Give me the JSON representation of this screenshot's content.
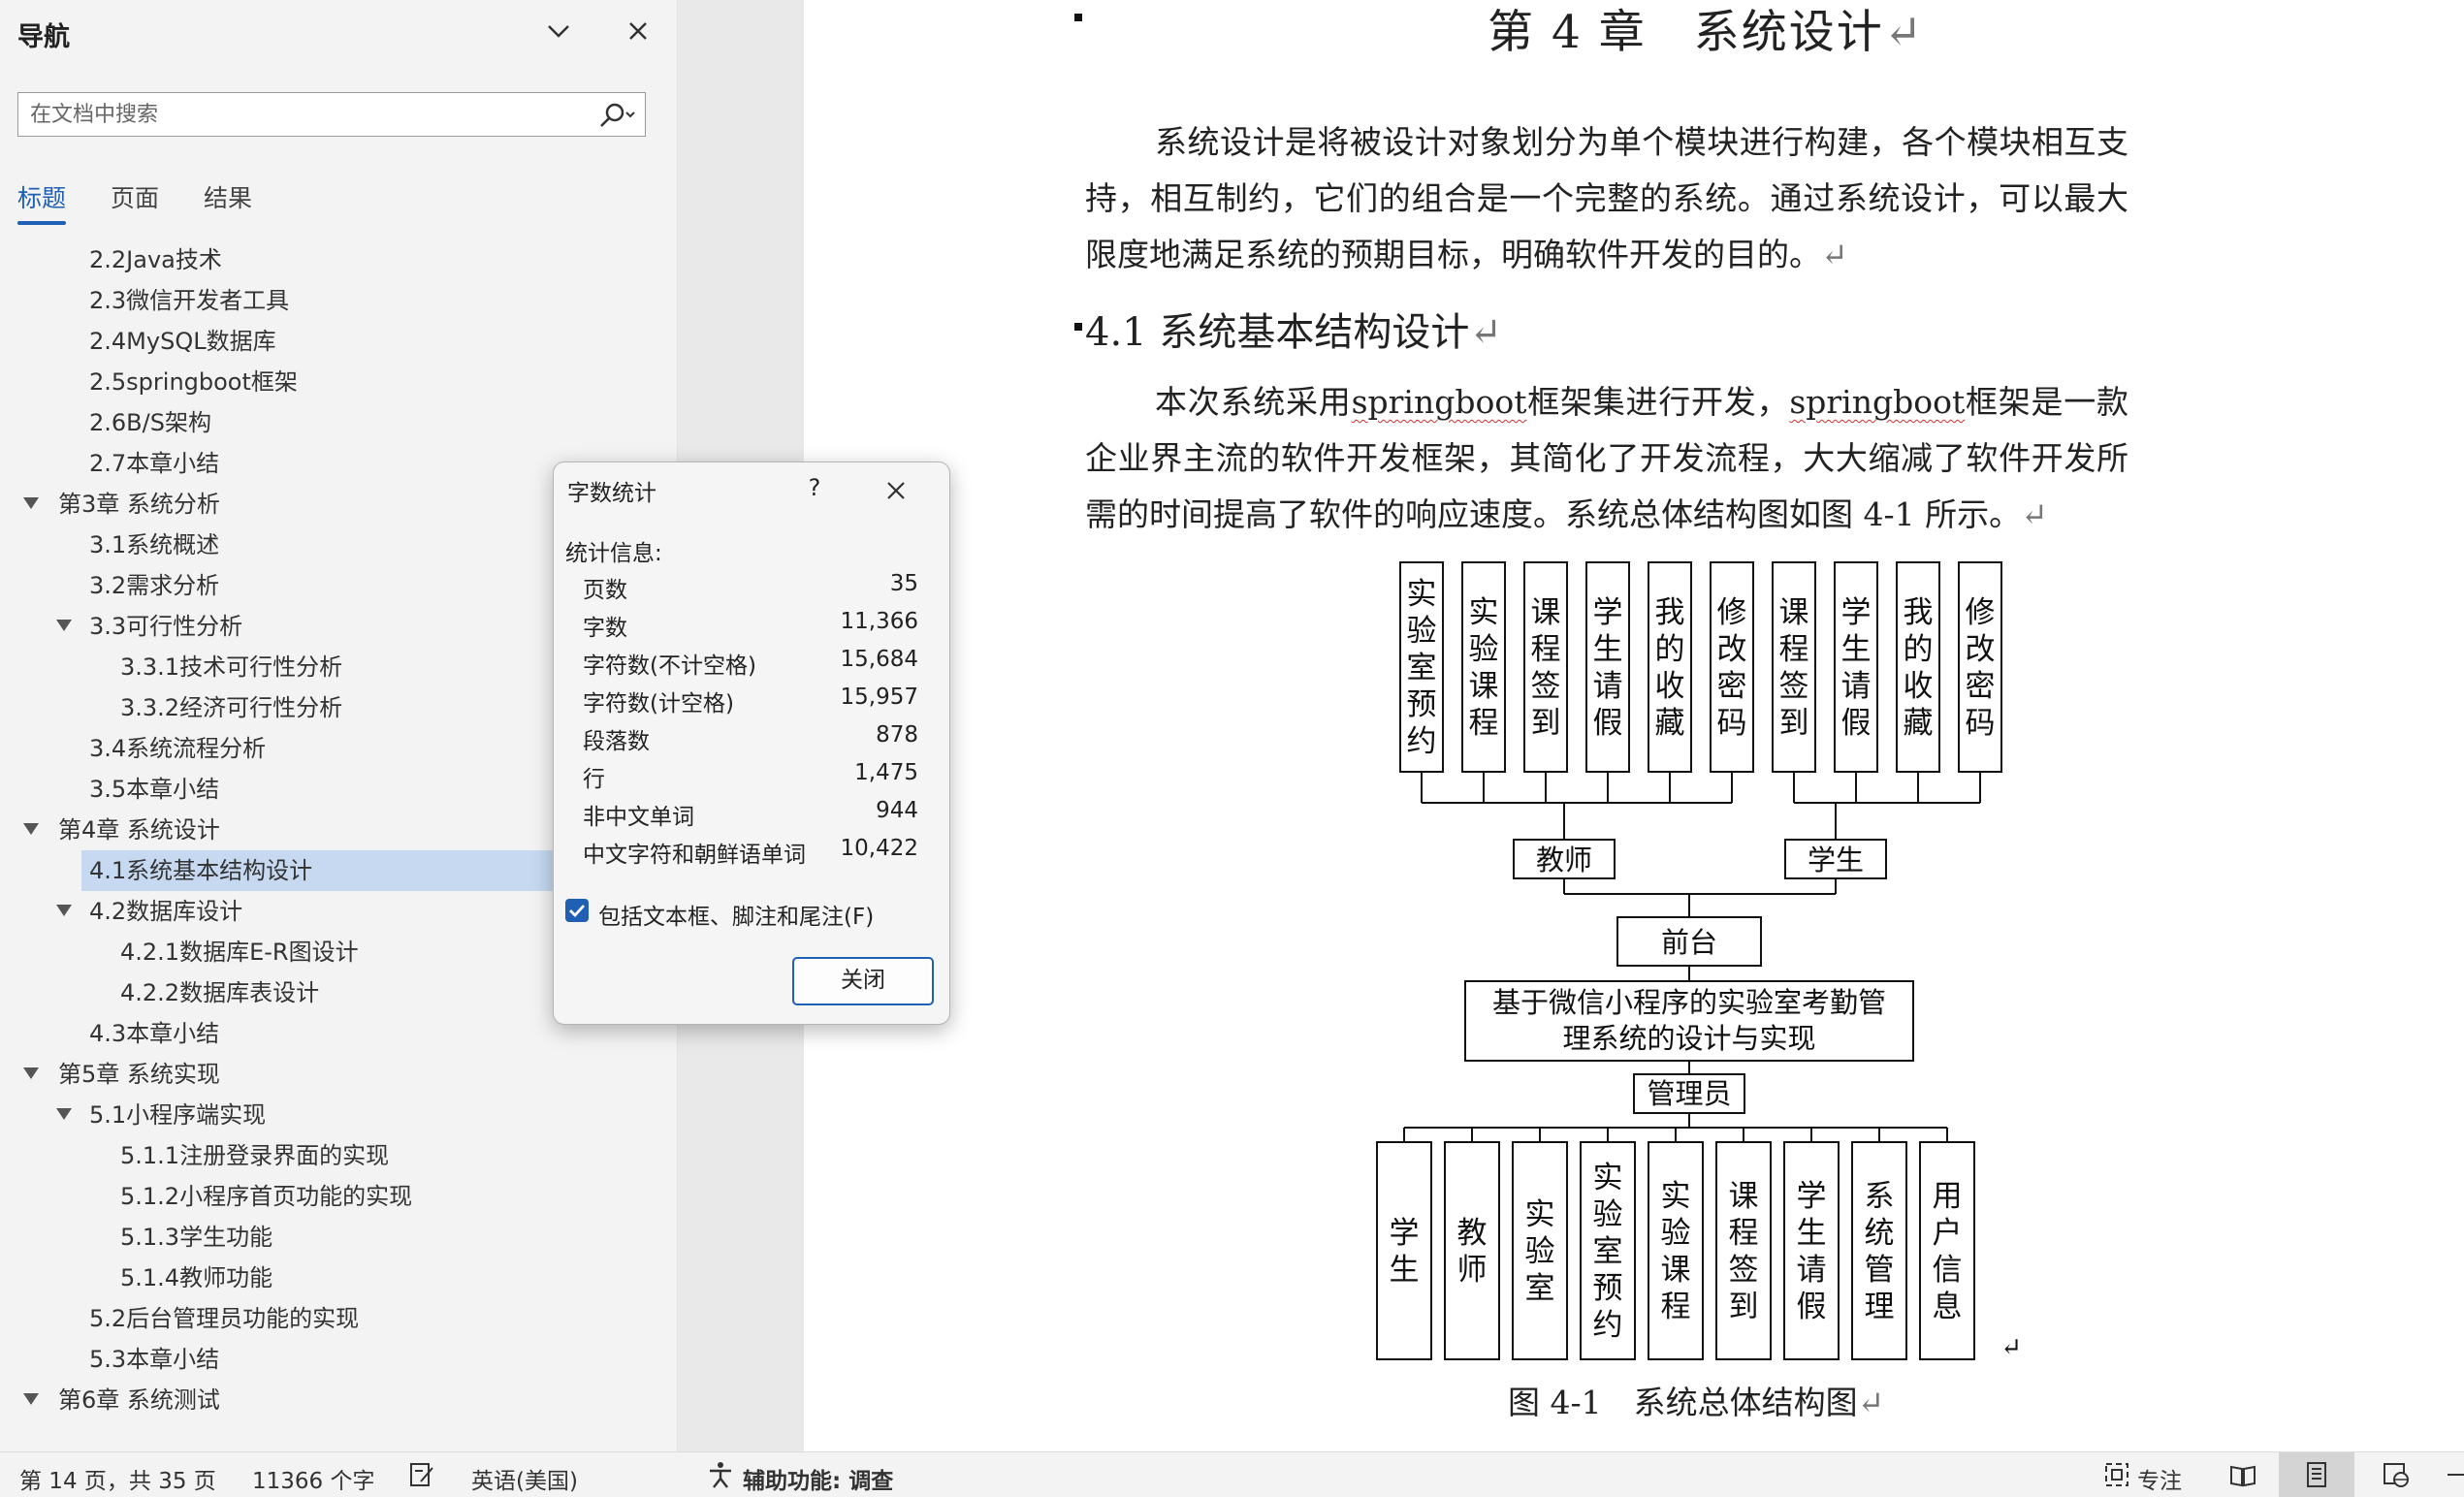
{
  "nav": {
    "title": "导航",
    "search_placeholder": "在文档中搜索",
    "tabs": [
      "标题",
      "页面",
      "结果"
    ],
    "outline": [
      {
        "text": "2.2Java技术",
        "level": 2,
        "arrow": false
      },
      {
        "text": "2.3微信开发者工具",
        "level": 2,
        "arrow": false
      },
      {
        "text": "2.4MySQL数据库",
        "level": 2,
        "arrow": false
      },
      {
        "text": "2.5springboot框架",
        "level": 2,
        "arrow": false
      },
      {
        "text": "2.6B/S架构",
        "level": 2,
        "arrow": false
      },
      {
        "text": "2.7本章小结",
        "level": 2,
        "arrow": false
      },
      {
        "text": "第3章 系统分析",
        "level": 1,
        "arrow": true
      },
      {
        "text": "3.1系统概述",
        "level": 2,
        "arrow": false
      },
      {
        "text": "3.2需求分析",
        "level": 2,
        "arrow": false
      },
      {
        "text": "3.3可行性分析",
        "level": 2,
        "arrow": true
      },
      {
        "text": "3.3.1技术可行性分析",
        "level": 3,
        "arrow": false
      },
      {
        "text": "3.3.2经济可行性分析",
        "level": 3,
        "arrow": false
      },
      {
        "text": "3.4系统流程分析",
        "level": 2,
        "arrow": false
      },
      {
        "text": "3.5本章小结",
        "level": 2,
        "arrow": false
      },
      {
        "text": "第4章 系统设计",
        "level": 1,
        "arrow": true
      },
      {
        "text": "4.1系统基本结构设计",
        "level": 2,
        "arrow": false,
        "selected": true
      },
      {
        "text": "4.2数据库设计",
        "level": 2,
        "arrow": true
      },
      {
        "text": "4.2.1数据库E-R图设计",
        "level": 3,
        "arrow": false
      },
      {
        "text": "4.2.2数据库表设计",
        "level": 3,
        "arrow": false
      },
      {
        "text": "4.3本章小结",
        "level": 2,
        "arrow": false
      },
      {
        "text": "第5章 系统实现",
        "level": 1,
        "arrow": true
      },
      {
        "text": "5.1小程序端实现",
        "level": 2,
        "arrow": true
      },
      {
        "text": "5.1.1注册登录界面的实现",
        "level": 3,
        "arrow": false
      },
      {
        "text": "5.1.2小程序首页功能的实现",
        "level": 3,
        "arrow": false
      },
      {
        "text": "5.1.3学生功能",
        "level": 3,
        "arrow": false
      },
      {
        "text": "5.1.4教师功能",
        "level": 3,
        "arrow": false
      },
      {
        "text": "5.2后台管理员功能的实现",
        "level": 2,
        "arrow": false
      },
      {
        "text": "5.3本章小结",
        "level": 2,
        "arrow": false
      },
      {
        "text": "第6章 系统测试",
        "level": 1,
        "arrow": true
      }
    ]
  },
  "doc": {
    "chapter_title": "第 4 章　系统设计",
    "para1": "系统设计是将被设计对象划分为单个模块进行构建，各个模块相互支持，相互制约，它们的组合是一个完整的系统。通过系统设计，可以最大限度地满足系统的预期目标，明确软件开发的目的。",
    "section_title": "4.1 系统基本结构设计",
    "para2_a": "本次系统采用",
    "para2_b": "springboot",
    "para2_c": "框架集进行开发，",
    "para2_d": "springboot",
    "para2_e": "框架是一款企业界主流的软件开发框架，其简化了开发流程，大大缩减了软件开发所需的时间提高了软件的响应速度。系统总体结构图如图 4-1 所示。",
    "para_mark": "↵",
    "figure": {
      "teacher_modules": [
        "实验室预约",
        "实验课程",
        "课程签到",
        "学生请假",
        "我的收藏",
        "修改密码"
      ],
      "student_modules": [
        "课程签到",
        "学生请假",
        "我的收藏",
        "修改密码"
      ],
      "teacher": "教师",
      "student": "学生",
      "frontend": "前台",
      "system_line1": "基于微信小程序的实验室考勤管",
      "system_line2": "理系统的设计与实现",
      "admin": "管理员",
      "admin_modules": [
        "学生",
        "教师",
        "实验室",
        "实验室预约",
        "实验课程",
        "课程签到",
        "学生请假",
        "系统管理",
        "用户信息"
      ]
    },
    "caption": "图 4-1　系统总体结构图"
  },
  "dialog": {
    "title": "字数统计",
    "help": "?",
    "stats_label": "统计信息:",
    "rows": [
      {
        "k": "页数",
        "v": "35"
      },
      {
        "k": "字数",
        "v": "11,366"
      },
      {
        "k": "字符数(不计空格)",
        "v": "15,684"
      },
      {
        "k": "字符数(计空格)",
        "v": "15,957"
      },
      {
        "k": "段落数",
        "v": "878"
      },
      {
        "k": "行",
        "v": "1,475"
      },
      {
        "k": "非中文单词",
        "v": "944"
      },
      {
        "k": "中文字符和朝鲜语单词",
        "v": "10,422"
      }
    ],
    "checkbox_label": "包括文本框、脚注和尾注(F)",
    "checkbox_checked": true,
    "close_label": "关闭"
  },
  "status": {
    "page": "第 14 页，共 35 页",
    "words": "11366 个字",
    "language": "英语(美国)",
    "a11y": "辅助功能: 调查",
    "focus": "专注"
  },
  "colors": {
    "accent": "#1f5fb4",
    "selection": "#c6d9f1",
    "nav_bg": "#f3f3f3"
  }
}
